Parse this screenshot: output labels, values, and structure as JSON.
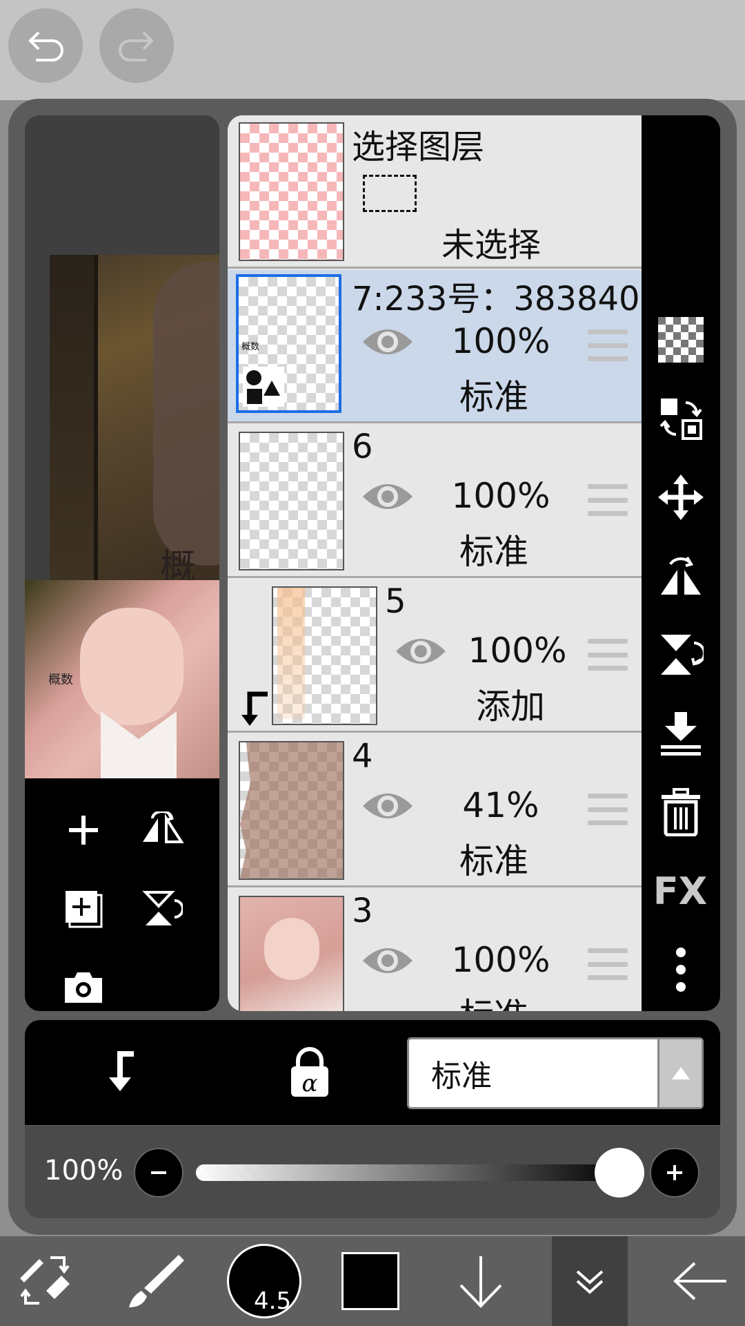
{
  "header": {
    "undo_icon": "undo-icon",
    "redo_icon": "redo-icon"
  },
  "preview": {
    "canvas_text": "概数",
    "thumb_text": "概数"
  },
  "canvas_tools": [
    {
      "icon": "plus-icon"
    },
    {
      "icon": "flip-horizontal-icon"
    },
    {
      "icon": "add-layer-copy-icon"
    },
    {
      "icon": "flip-vertical-icon"
    },
    {
      "icon": "camera-icon"
    }
  ],
  "layers": {
    "selection": {
      "title": "选择图层",
      "status": "未选择"
    },
    "items": [
      {
        "name": "7:233号：383840",
        "opacity": "100%",
        "mode": "标准",
        "selected": true
      },
      {
        "name": "6",
        "opacity": "100%",
        "mode": "标准"
      },
      {
        "name": "5",
        "opacity": "100%",
        "mode": "添加",
        "clipped": true
      },
      {
        "name": "4",
        "opacity": "41%",
        "mode": "标准"
      },
      {
        "name": "3",
        "opacity": "100%",
        "mode": "标准"
      }
    ]
  },
  "sidebar": {
    "icons": [
      "transparency-icon",
      "swap-layer-icon",
      "move-icon",
      "flip-horizontal-icon",
      "flip-vertical-icon",
      "merge-down-icon",
      "trash-icon"
    ],
    "fx_label": "FX",
    "more_icon": "more-vertical-icon"
  },
  "bottom": {
    "blend_mode": "标准",
    "clip_icon": "clip-icon",
    "alpha_lock_icon": "alpha-lock-icon"
  },
  "opacity": {
    "label": "100%",
    "value": 1.0
  },
  "toolbar": {
    "brush_size": "4.5",
    "color": "#000000"
  },
  "colors": {
    "selected_row": "#cbd8ea",
    "accent": "#1d6ee6"
  }
}
